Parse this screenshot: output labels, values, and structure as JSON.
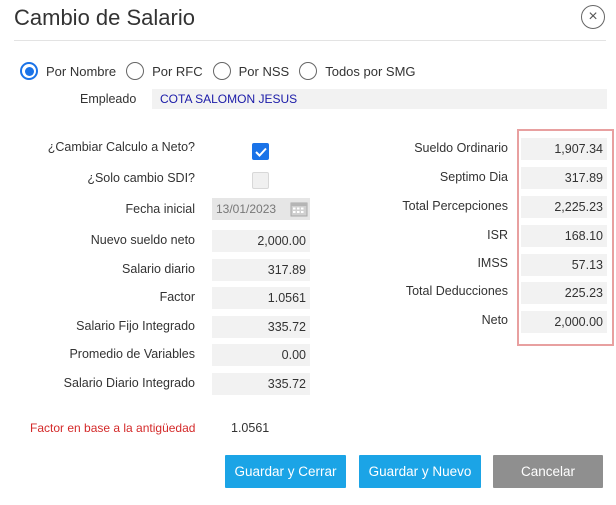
{
  "dialog": {
    "title": "Cambio de Salario",
    "close_glyph": "×"
  },
  "search_mode": {
    "options": [
      "Por Nombre",
      "Por RFC",
      "Por NSS",
      "Todos por SMG"
    ],
    "selected": "Por Nombre"
  },
  "employee": {
    "label": "Empleado",
    "value": "COTA SALOMON JESUS"
  },
  "left": {
    "cambiar_neto_label": "¿Cambiar Calculo a Neto?",
    "cambiar_neto_checked": true,
    "solo_sdi_label": "¿Solo cambio SDI?",
    "solo_sdi_checked": false,
    "fecha_label": "Fecha inicial",
    "fecha_value": "13/01/2023",
    "nuevo_sueldo_label": "Nuevo sueldo neto",
    "nuevo_sueldo_value": "2,000.00",
    "salario_diario_label": "Salario diario",
    "salario_diario_value": "317.89",
    "factor_label": "Factor",
    "factor_value": "1.0561",
    "sfi_label": "Salario Fijo Integrado",
    "sfi_value": "335.72",
    "promedio_label": "Promedio de Variables",
    "promedio_value": "0.00",
    "sdi_label": "Salario Diario Integrado",
    "sdi_value": "335.72"
  },
  "right": {
    "sueldo_ordinario_label": "Sueldo Ordinario",
    "sueldo_ordinario_value": "1,907.34",
    "septimo_label": "Septimo Dia",
    "septimo_value": "317.89",
    "total_percepciones_label": "Total Percepciones",
    "total_percepciones_value": "2,225.23",
    "isr_label": "ISR",
    "isr_value": "168.10",
    "imss_label": "IMSS",
    "imss_value": "57.13",
    "total_deducciones_label": "Total Deducciones",
    "total_deducciones_value": "225.23",
    "neto_label": "Neto",
    "neto_value": "2,000.00"
  },
  "footer_note": {
    "label": "Factor en base a la antigüedad",
    "value": "1.0561"
  },
  "buttons": {
    "guardar_cerrar": "Guardar y Cerrar",
    "guardar_nuevo": "Guardar y Nuevo",
    "cancelar": "Cancelar"
  },
  "colors": {
    "accent": "#1a73e8",
    "button_primary": "#1ba4e6",
    "button_cancel": "#8f8f8f",
    "warning_text": "#d42a2a",
    "summary_border": "#e8a0a0",
    "employee_text": "#1a1aa8"
  },
  "icons": {
    "calendar": "calendar-icon",
    "check": "checkmark-icon",
    "close": "close-icon"
  }
}
